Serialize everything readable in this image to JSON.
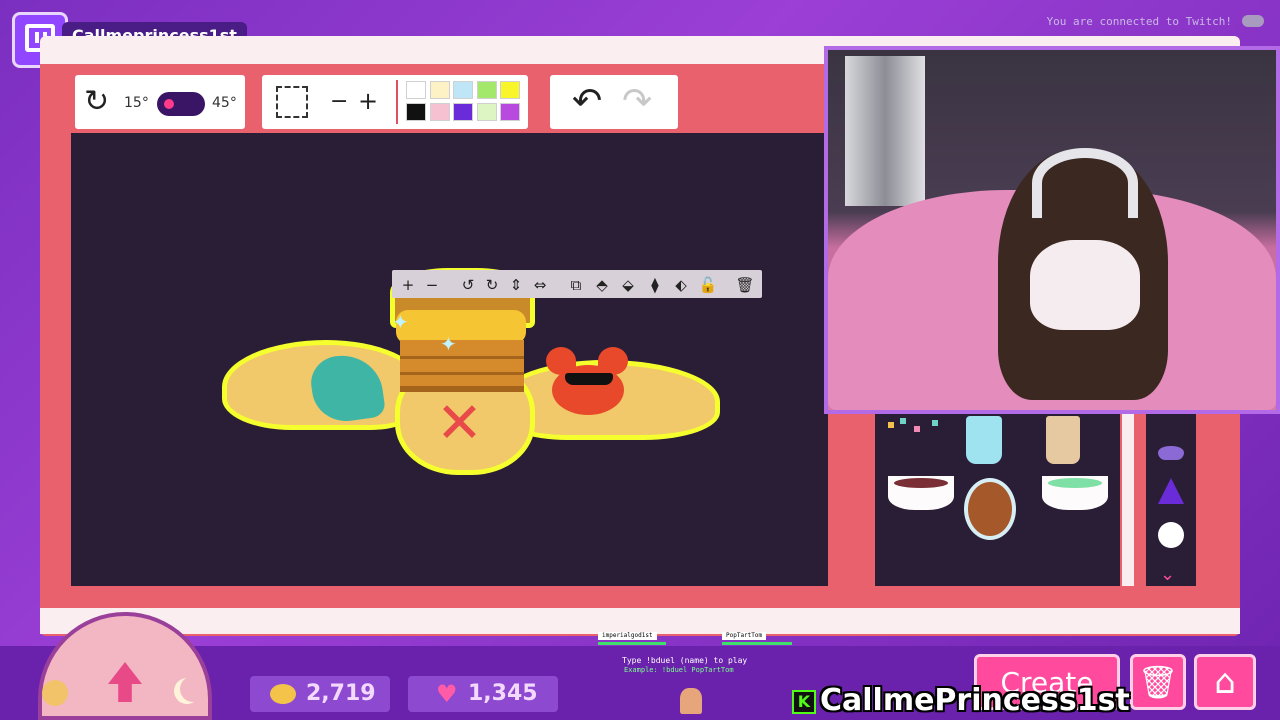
{
  "header": {
    "channel": "Callmeprincess1st",
    "status": "You are connected to Twitch!"
  },
  "toolbar": {
    "rotation_min": "15°",
    "rotation_max": "45°",
    "zoom_out": "−",
    "zoom_in": "+",
    "undo_icon": "↶",
    "redo_icon": "↷",
    "colors": [
      "#ffffff",
      "#fdf1c6",
      "#bfe6f7",
      "#a3e86a",
      "#f9f52b",
      "#111111",
      "#f6c2d1",
      "#6a2bd8",
      "#dcf5c2",
      "#b84ae0"
    ]
  },
  "object_toolbar": {
    "tools": [
      {
        "name": "zoom-in-icon",
        "glyph": "+"
      },
      {
        "name": "zoom-out-icon",
        "glyph": "−"
      },
      {
        "name": "rotate-left-icon",
        "glyph": "↺"
      },
      {
        "name": "rotate-right-icon",
        "glyph": "↻"
      },
      {
        "name": "flip-vertical-icon",
        "glyph": "⇕"
      },
      {
        "name": "flip-horizontal-icon",
        "glyph": "⇔"
      },
      {
        "name": "duplicate-icon",
        "glyph": "⧉"
      },
      {
        "name": "layer-up-icon",
        "glyph": "⬘"
      },
      {
        "name": "layer-down-icon",
        "glyph": "⬙"
      },
      {
        "name": "send-back-icon",
        "glyph": "⧫"
      },
      {
        "name": "bring-front-icon",
        "glyph": "⬖"
      },
      {
        "name": "lock-icon",
        "glyph": "🔓"
      },
      {
        "name": "delete-icon",
        "glyph": "🗑"
      }
    ]
  },
  "stats": {
    "coins": "2,719",
    "hearts": "1,345"
  },
  "duel": {
    "player1": "imperialgod1st",
    "player2": "PopTartTom",
    "help": "Type !bduel (name) to play",
    "example": "Example: !bduel PopTartTom"
  },
  "buttons": {
    "create": "Create",
    "trash_icon": "🗑",
    "home_icon": "⌂"
  },
  "footer": {
    "kick_logo": "K",
    "kick_name": "CallmePrincess1st"
  }
}
